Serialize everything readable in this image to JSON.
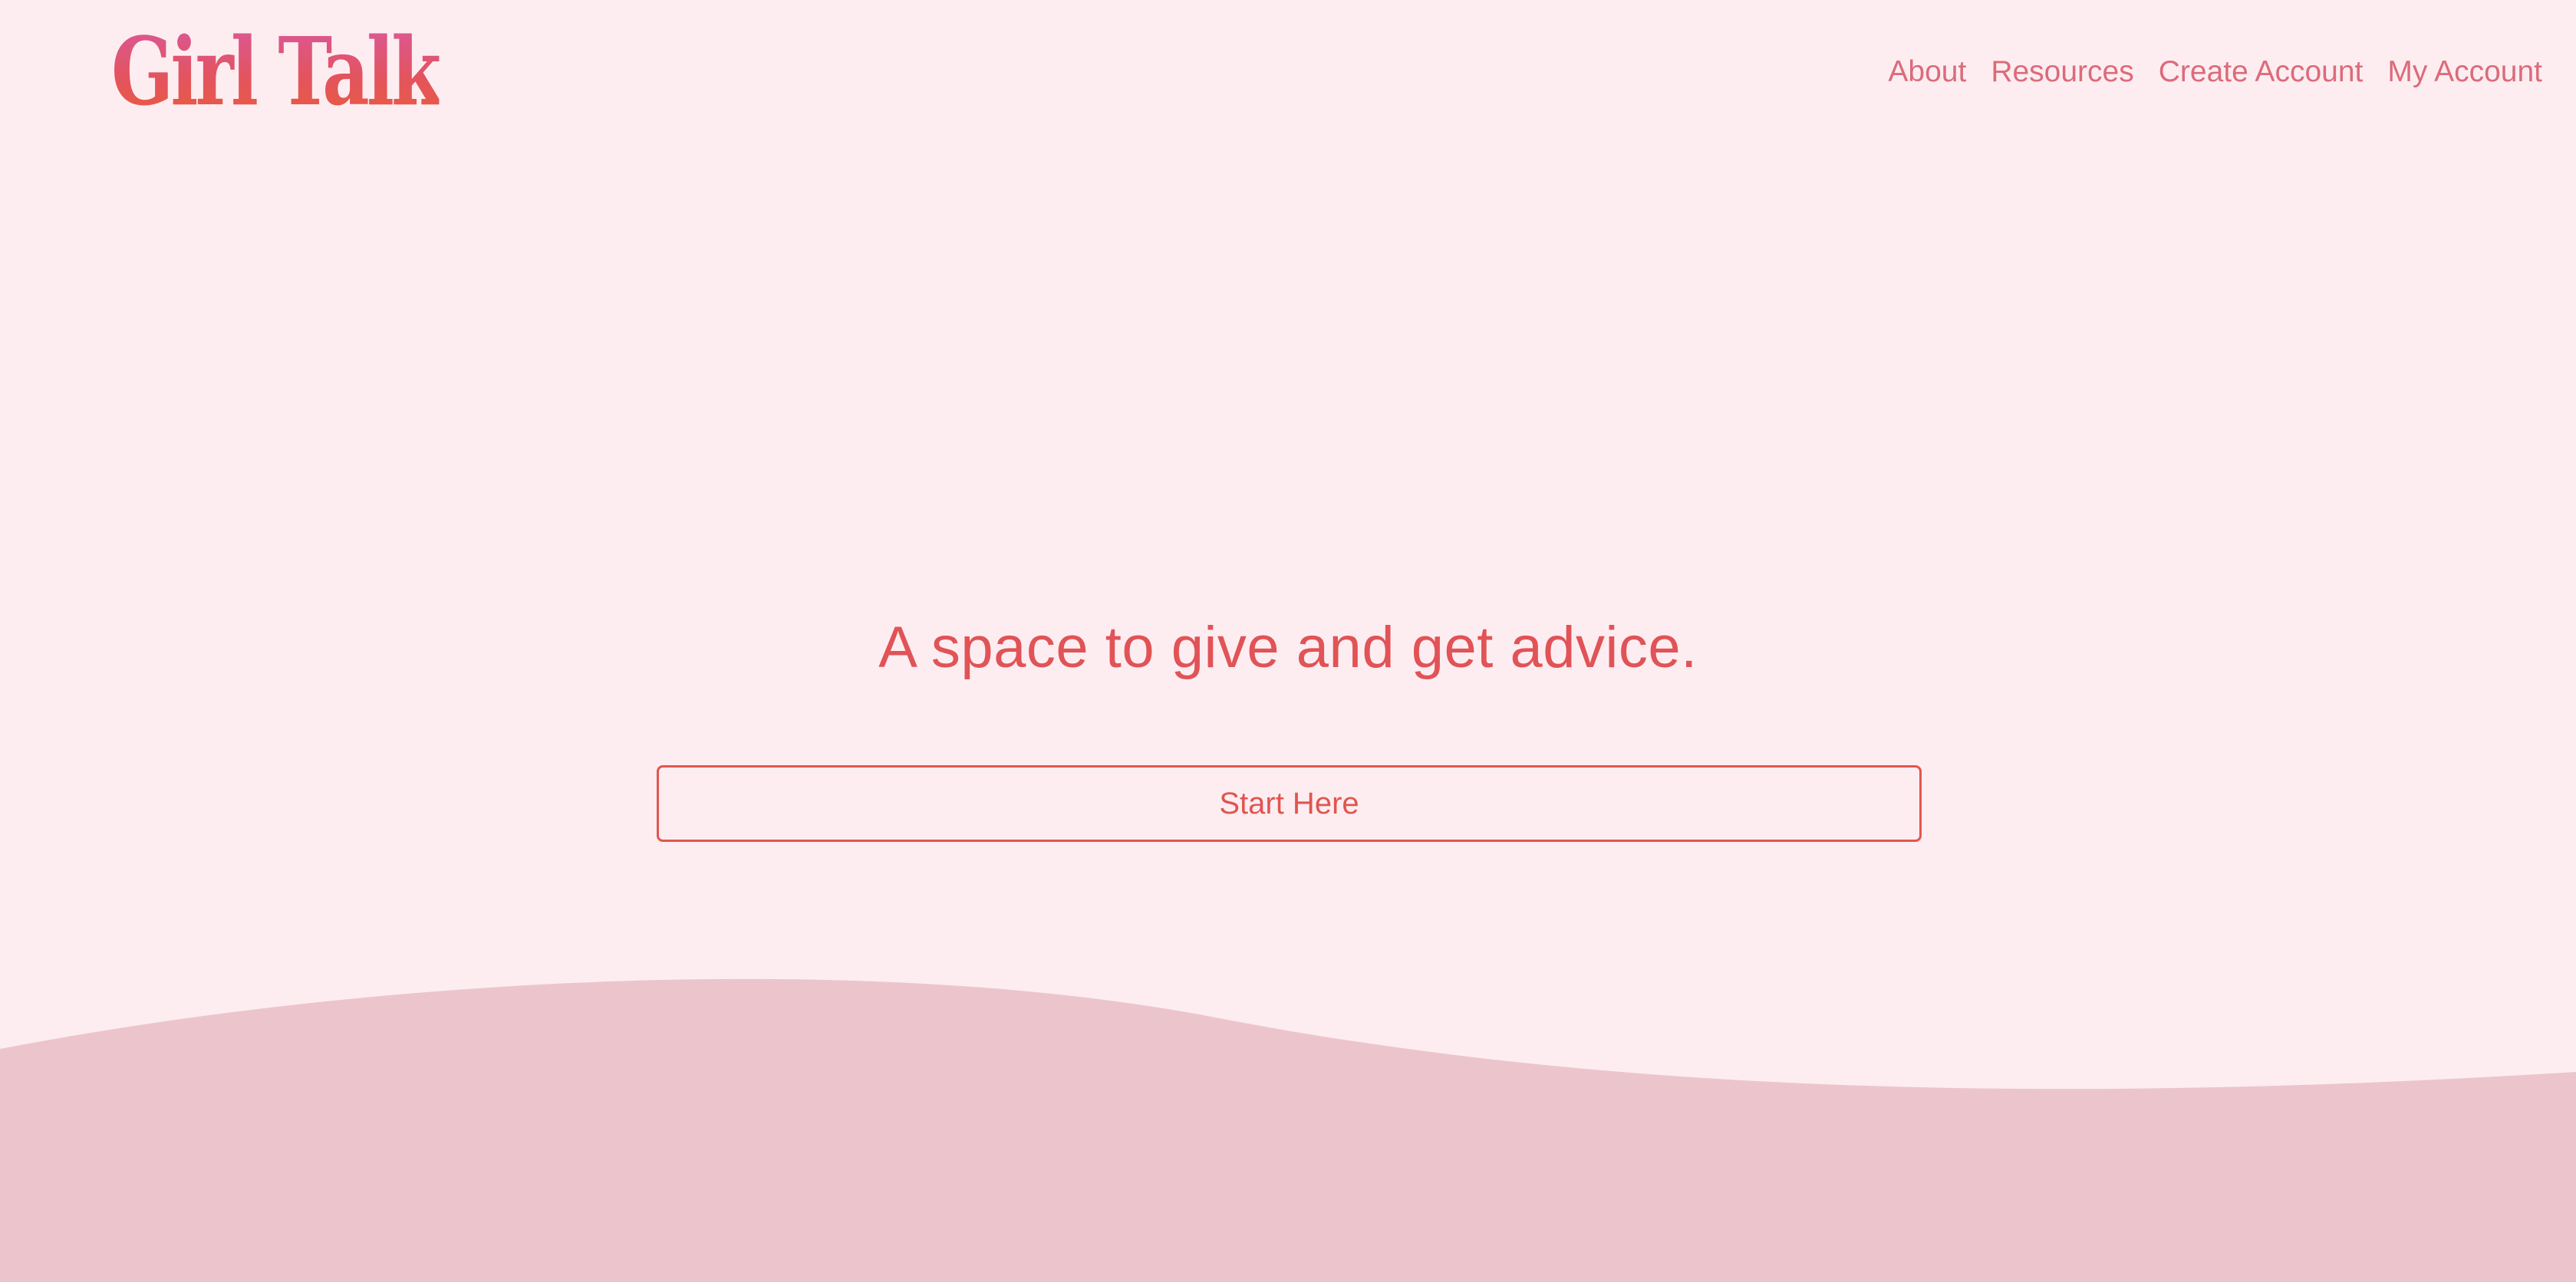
{
  "header": {
    "logo_text": "Girl Talk",
    "nav": [
      {
        "label": "About"
      },
      {
        "label": "Resources"
      },
      {
        "label": "Create Account"
      },
      {
        "label": "My Account"
      }
    ]
  },
  "hero": {
    "tagline": "A space to give and get advice.",
    "cta_label": "Start Here"
  },
  "colors": {
    "background": "#fdedf1",
    "wave": "#ecc5cc",
    "accent": "#e15356",
    "nav_text": "#dc6b7a"
  }
}
